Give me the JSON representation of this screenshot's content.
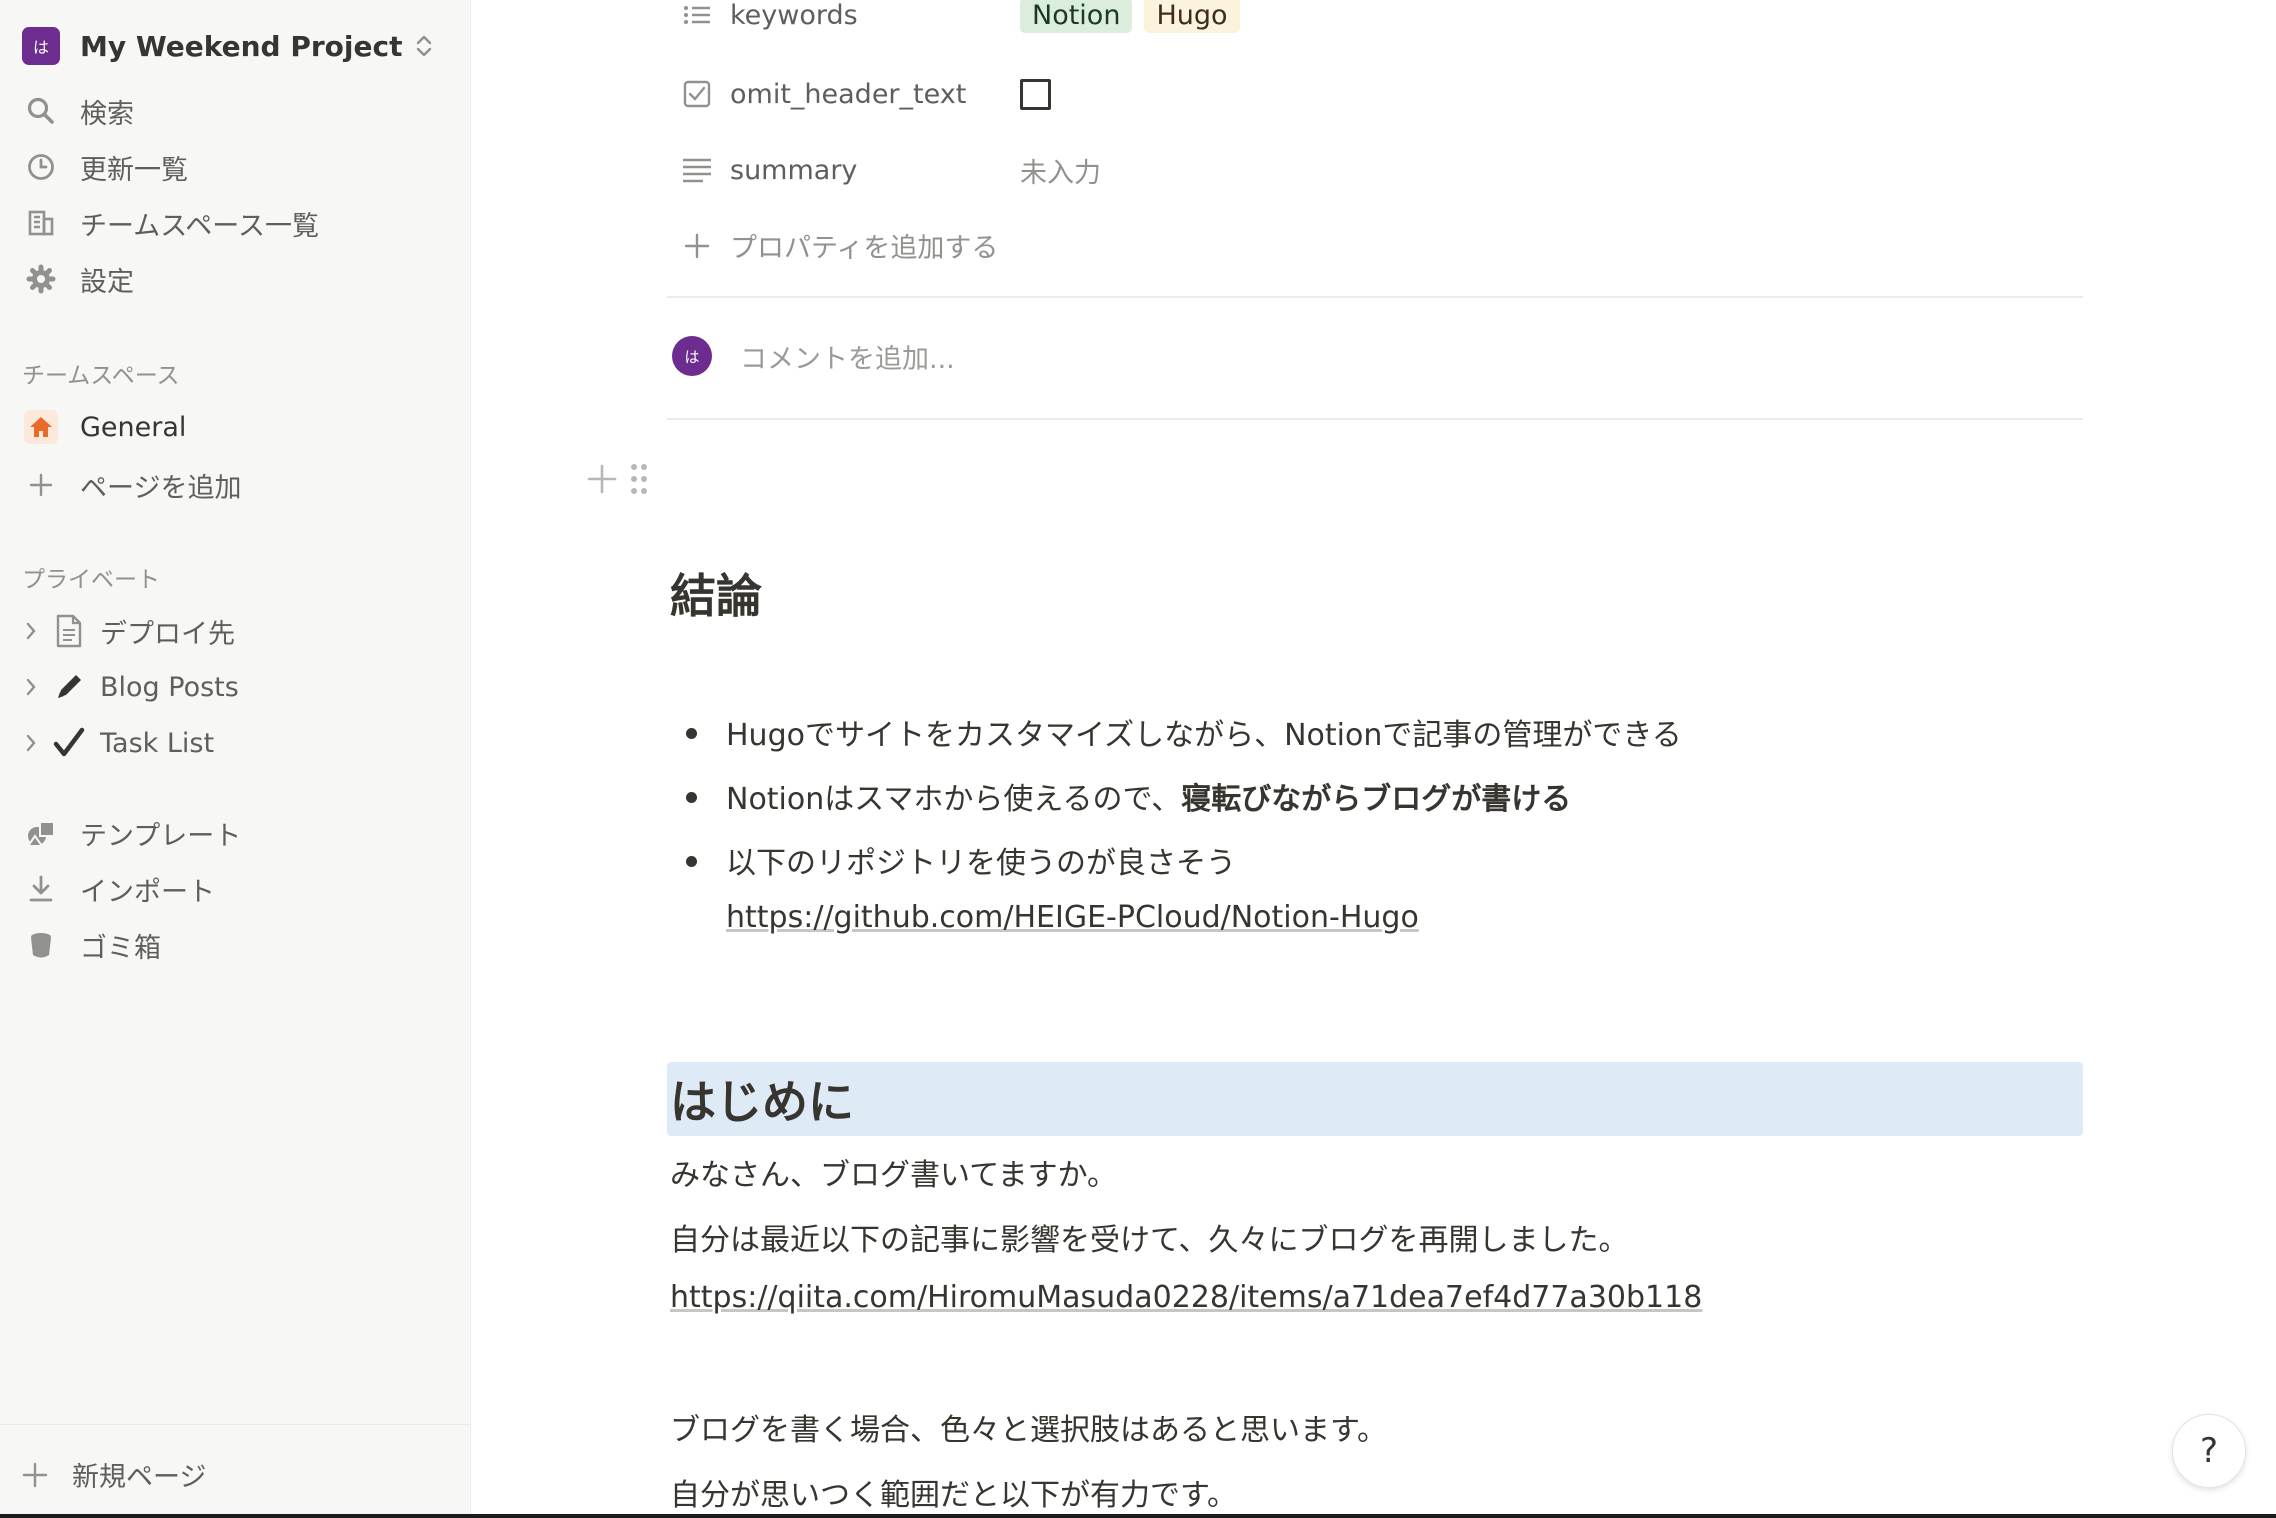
{
  "sidebar": {
    "workspace": {
      "avatar": "は",
      "name": "My Weekend Project"
    },
    "nav": [
      {
        "label": "検索",
        "icon": "search-icon"
      },
      {
        "label": "更新一覧",
        "icon": "clock-icon"
      },
      {
        "label": "チームスペース一覧",
        "icon": "building-icon"
      },
      {
        "label": "設定",
        "icon": "gear-icon"
      }
    ],
    "teamspace_section": "チームスペース",
    "teamspace_items": [
      {
        "label": "General",
        "icon": "home-icon"
      },
      {
        "label": "ページを追加",
        "icon": "plus-icon"
      }
    ],
    "private_section": "プライベート",
    "private_items": [
      {
        "label": "デプロイ先",
        "icon": "document-icon"
      },
      {
        "label": "Blog Posts",
        "icon": "pencil-icon"
      },
      {
        "label": "Task List",
        "icon": "checkmark-icon"
      }
    ],
    "tools": [
      {
        "label": "テンプレート",
        "icon": "shapes-icon"
      },
      {
        "label": "インポート",
        "icon": "download-icon"
      },
      {
        "label": "ゴミ箱",
        "icon": "trash-icon"
      }
    ],
    "new_page": "新規ページ"
  },
  "properties": {
    "keywords": {
      "name": "keywords",
      "tags": [
        "Notion",
        "Hugo"
      ]
    },
    "omit_header_text": {
      "name": "omit_header_text",
      "checked": false
    },
    "summary": {
      "name": "summary",
      "value": "未入力"
    },
    "add_property": "プロパティを追加する"
  },
  "comment": {
    "avatar": "は",
    "placeholder": "コメントを追加..."
  },
  "content": {
    "conclusion_heading": "結論",
    "bullets": {
      "b1": "Hugoでサイトをカスタマイズしながら、Notionで記事の管理ができる",
      "b2_plain": "Notionはスマホから使えるので、",
      "b2_bold": "寝転びながらブログが書ける",
      "b3": "以下のリポジトリを使うのが良さそう"
    },
    "repo_link": "https://github.com/HEIGE-PCloud/Notion-Hugo",
    "intro_heading": "はじめに",
    "p1": "みなさん、ブログ書いてますか。",
    "p2": "自分は最近以下の記事に影響を受けて、久々にブログを再開しました。",
    "qiita_link": "https://qiita.com/HiromuMasuda0228/items/a71dea7ef4d77a30b118",
    "p3": "ブログを書く場合、色々と選択肢はあると思います。",
    "p4": "自分が思いつく範囲だと以下が有力です。"
  },
  "help": "?",
  "colors": {
    "accent_purple": "#6d2c8f",
    "highlight_blue": "#deebf7",
    "home_orange": "#e86b2a"
  }
}
